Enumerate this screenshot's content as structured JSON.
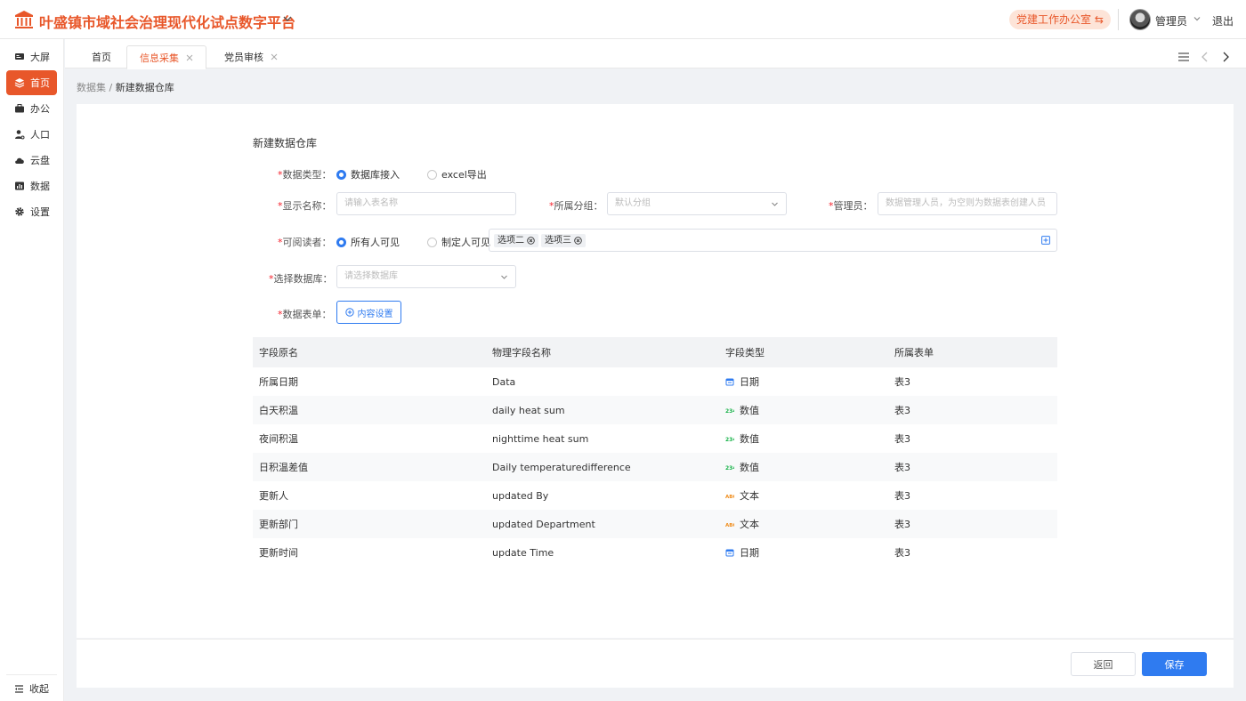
{
  "header": {
    "title": "叶盛镇市域社会治理现代化试点数字平台",
    "office_switch": "党建工作办公室 ⇆",
    "username": "管理员",
    "logout": "退出"
  },
  "sidebar": {
    "items": [
      {
        "label": "大屏",
        "icon": "screen-icon"
      },
      {
        "label": "首页",
        "icon": "layers-icon"
      },
      {
        "label": "办公",
        "icon": "briefcase-icon"
      },
      {
        "label": "人口",
        "icon": "person-icon"
      },
      {
        "label": "云盘",
        "icon": "cloud-icon"
      },
      {
        "label": "数据",
        "icon": "chart-icon"
      },
      {
        "label": "设置",
        "icon": "gear-icon"
      }
    ],
    "active_index": 1,
    "collapse": "收起"
  },
  "tabs": [
    {
      "label": "首页"
    },
    {
      "label": "信息采集"
    },
    {
      "label": "党员审核"
    }
  ],
  "breadcrumb": {
    "parent": "数据集",
    "separator": "/",
    "current": "新建数据仓库"
  },
  "form": {
    "title": "新建数据仓库",
    "data_type": {
      "label": "数据类型：",
      "options": [
        "数据库接入",
        "excel导出"
      ],
      "selected": "数据库接入"
    },
    "display_name": {
      "label": "显示名称：",
      "placeholder": "请输入表名称"
    },
    "group": {
      "label": "所属分组：",
      "placeholder": "默认分组"
    },
    "admin": {
      "label": "管理员：",
      "placeholder": "数据管理人员，为空则为数据表创建人员"
    },
    "readers": {
      "label": "可阅读者：",
      "options": [
        "所有人可见",
        "制定人可见"
      ],
      "selected": "所有人可见",
      "tags": [
        "选项二",
        "选项三"
      ]
    },
    "database": {
      "label": "选择数据库：",
      "placeholder": "请选择数据库"
    },
    "sheet": {
      "label": "数据表单：",
      "button": "内容设置"
    }
  },
  "table": {
    "headers": [
      "字段原名",
      "物理字段名称",
      "字段类型",
      "所属表单"
    ],
    "rows": [
      {
        "name": "所属日期",
        "field": "Data",
        "type": "日期",
        "type_icon": "calendar-icon",
        "sheet": "表3"
      },
      {
        "name": "白天积温",
        "field": "daily heat sum",
        "type": "数值",
        "type_icon": "number-icon",
        "sheet": "表3"
      },
      {
        "name": "夜间积温",
        "field": "nighttime heat sum",
        "type": "数值",
        "type_icon": "number-icon",
        "sheet": "表3"
      },
      {
        "name": "日积温差值",
        "field": "Daily temperaturedifference",
        "type": "数值",
        "type_icon": "number-icon",
        "sheet": "表3"
      },
      {
        "name": "更新人",
        "field": "updated By",
        "type": "文本",
        "type_icon": "text-icon",
        "sheet": "表3"
      },
      {
        "name": "更新部门",
        "field": "updated Department",
        "type": "文本",
        "type_icon": "text-icon",
        "sheet": "表3"
      },
      {
        "name": "更新时间",
        "field": "update Time",
        "type": "日期",
        "type_icon": "calendar-icon",
        "sheet": "表3"
      }
    ]
  },
  "footer": {
    "back": "返回",
    "save": "保存"
  },
  "colors": {
    "brand": "#e8572a",
    "primary": "#2f7bf0",
    "required": "#f5222d"
  }
}
